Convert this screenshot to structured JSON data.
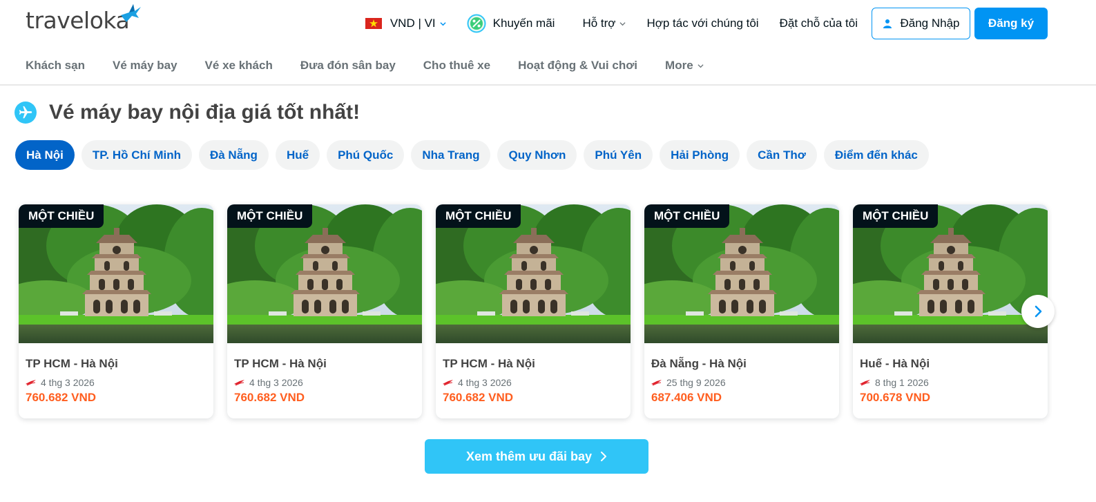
{
  "header": {
    "logo": "traveloka",
    "currency": "VND | VI",
    "promo": "Khuyến mãi",
    "support": "Hỗ trợ",
    "partner": "Hợp tác với chúng tôi",
    "bookings": "Đặt chỗ của tôi",
    "login": "Đăng Nhập",
    "signup": "Đăng ký"
  },
  "subnav": [
    "Khách sạn",
    "Vé máy bay",
    "Vé xe khách",
    "Đưa đón sân bay",
    "Cho thuê xe",
    "Hoạt động & Vui chơi",
    "More"
  ],
  "section": {
    "title": "Vé máy bay nội địa giá tốt nhất!"
  },
  "chips": [
    "Hà Nội",
    "TP. Hồ Chí Minh",
    "Đà Nẵng",
    "Huế",
    "Phú Quốc",
    "Nha Trang",
    "Quy Nhơn",
    "Phú Yên",
    "Hải Phòng",
    "Cần Thơ",
    "Điểm đến khác"
  ],
  "active_chip": "Hà Nội",
  "cards": [
    {
      "badge": "MỘT CHIỀU",
      "route": "TP HCM - Hà Nội",
      "date": "4 thg 3 2026",
      "price": "760.682 VND"
    },
    {
      "badge": "MỘT CHIỀU",
      "route": "TP HCM - Hà Nội",
      "date": "4 thg 3 2026",
      "price": "760.682 VND"
    },
    {
      "badge": "MỘT CHIỀU",
      "route": "TP HCM - Hà Nội",
      "date": "4 thg 3 2026",
      "price": "760.682 VND"
    },
    {
      "badge": "MỘT CHIỀU",
      "route": "Đà Nẵng - Hà Nội",
      "date": "25 thg 9 2026",
      "price": "687.406 VND"
    },
    {
      "badge": "MỘT CHIỀU",
      "route": "Huế - Hà Nội",
      "date": "8 thg 1 2026",
      "price": "700.678 VND"
    }
  ],
  "more_button": "Xem thêm ưu đãi bay",
  "colors": {
    "brand_blue": "#0194f3",
    "chip_active": "#0264c8",
    "accent_cyan": "#30c5f7",
    "price_orange": "#ff5e1f"
  },
  "icons": {
    "flag": "vietnam-flag-icon",
    "promo": "percent-badge-icon",
    "user": "user-icon",
    "plane": "airplane-icon",
    "airline": "airline-logo-icon",
    "next": "chevron-right-icon"
  }
}
